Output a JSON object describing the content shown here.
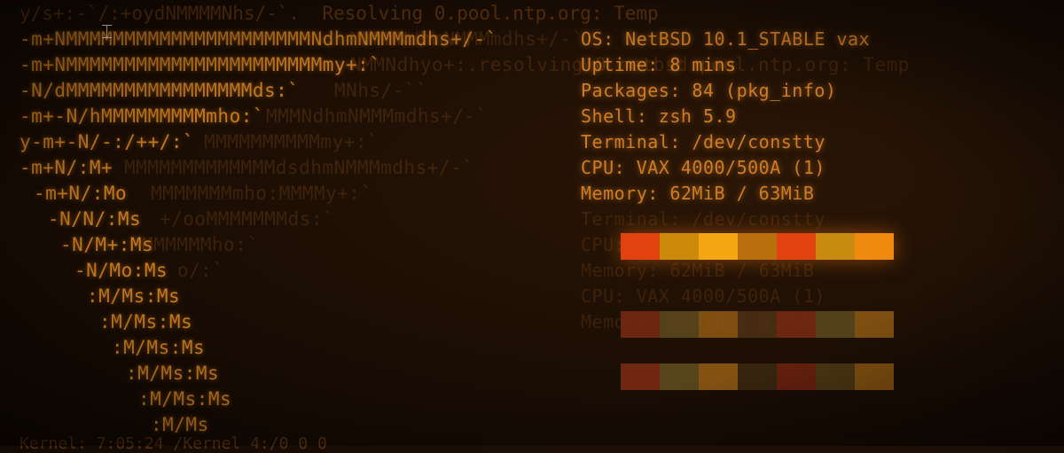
{
  "top_line": "y/s+:-`/:+oydNMMMMNhs/-`.  Resolving 0.pool.ntp.org: Temp",
  "logo": [
    "-m+NMMMMMMMMMMMMMMMMMMMMMNdhmNMMMmdhs+/-`",
    "-m+NMMMMMMMMMMMMMMMMMMMMMMmy+:`",
    "-N/dMMMMMMMMMMMMMMMMds:`",
    "-m+-N/hMMMMMMMMMmho:`",
    "y-m+-N/-:/++/:`",
    "-m+N/:M+",
    "-m+N/:Mo",
    "-N/N/:Ms",
    "-N/M+:Ms",
    "-N/Mo:Ms",
    ":M/Ms:Ms",
    ":M/Ms:Ms",
    ":M/Ms:Ms",
    ":M/Ms:Ms",
    ":M/Ms:Ms",
    ":M/Ms"
  ],
  "logo_ghost": [
    "MMMMNdhmNMMMmdhs+/-`",
    "NMMNdhyo+:.resolving 0.netbsd.pool.ntp.org: Temp",
    "MNhs/-``",
    "MMMNdhmNMMMmdhs+/-`",
    "MMMMMMMMMMmy+:`",
    "MMMMMMMMMMMMMdsdhmNMMMmdhs+/-`",
    "MMMMMMMmho:MMMMy+:`",
    "+/ooMMMMMMMds:`",
    "MMMMMMho:`",
    "o/:`",
    "",
    "",
    "",
    "",
    "",
    ""
  ],
  "info": {
    "os": "OS: NetBSD 10.1_STABLE vax",
    "uptime": "Uptime: 8 mins",
    "packages": "Packages: 84 (pkg_info)",
    "shell": "Shell: zsh 5.9",
    "terminal": "Terminal: /dev/constty",
    "cpu": "CPU: VAX 4000/500A (1)",
    "memory": "Memory: 62MiB / 63MiB"
  },
  "ghost_info": [
    "Terminal: /dev/constty",
    "CPU: VAX 4000/500A (1)",
    "Memory: 62MiB / 63MiB",
    "CPU: VAX 4000/500A (1)",
    "Memory: 62MiB / 63MiB"
  ],
  "palette": {
    "row1": [
      "#e2420e",
      "#cc8a0a",
      "#f2a612",
      "#b9700c",
      "#e2420e",
      "#c98a10",
      "#f08a0e"
    ],
    "row2": [
      "#7a2a14",
      "#5f4a1e",
      "#8f5a14",
      "#4e3214",
      "#7a2a14",
      "#5f4a1e",
      "#8f5a14"
    ],
    "row3": [
      "#7a2a14",
      "#5f4a1e",
      "#8f5a14",
      "#3a2810",
      "#6e2210",
      "#4f3a14",
      "#8a5612"
    ]
  },
  "status_line": "Kernel: 7:05:24 /Kernel 4:/0 0 0"
}
